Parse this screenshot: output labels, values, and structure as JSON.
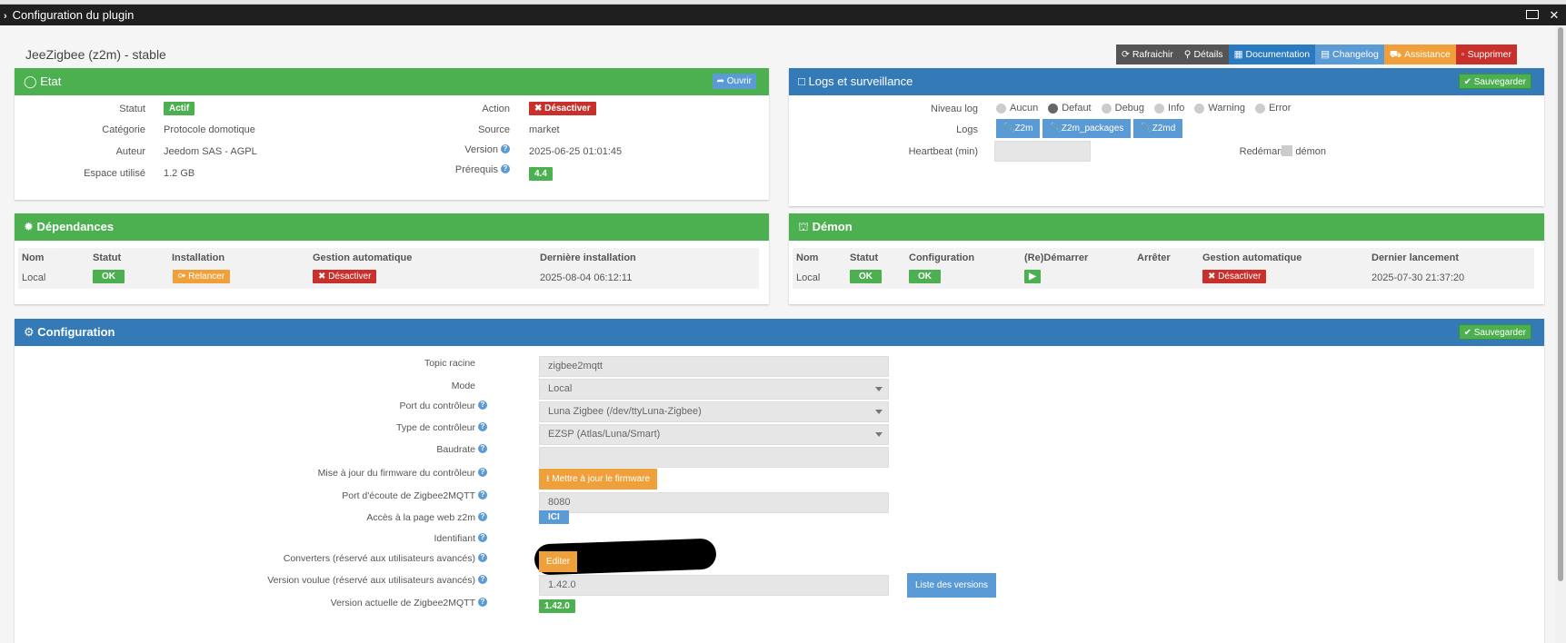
{
  "window": {
    "title": "Configuration du plugin"
  },
  "plugin": {
    "title": "JeeZigbee (z2m) - stable"
  },
  "toolbar": {
    "refresh": "Rafraichir",
    "details": "Détails",
    "documentation": "Documentation",
    "changelog": "Changelog",
    "assistance": "Assistance",
    "delete": "Supprimer"
  },
  "etat": {
    "title": "Etat",
    "open_button": "Ouvrir",
    "statut_label": "Statut",
    "statut_value": "Actif",
    "categorie_label": "Catégorie",
    "categorie_value": "Protocole domotique",
    "auteur_label": "Auteur",
    "auteur_value": "Jeedom SAS - AGPL",
    "espace_label": "Espace utilisé",
    "espace_value": "1.2 GB",
    "action_label": "Action",
    "action_value": "Désactiver",
    "source_label": "Source",
    "source_value": "market",
    "version_label": "Version",
    "version_value": "2025-06-25 01:01:45",
    "prerequis_label": "Prérequis",
    "prerequis_value": "4.4"
  },
  "logs": {
    "title": "Logs et surveillance",
    "save_button": "Sauvegarder",
    "niveau_label": "Niveau log",
    "levels": [
      "Aucun",
      "Defaut",
      "Debug",
      "Info",
      "Warning",
      "Error"
    ],
    "selected_level": "Defaut",
    "logs_label": "Logs",
    "log_buttons": [
      "Z2m",
      "Z2m_packages",
      "Z2md"
    ],
    "heartbeat_label": "Heartbeat (min)",
    "heartbeat_value": "",
    "restart_label": "Redémarrer démon"
  },
  "dependances": {
    "title": "Dépendances",
    "headers": [
      "Nom",
      "Statut",
      "Installation",
      "Gestion automatique",
      "Dernière installation"
    ],
    "row": {
      "nom": "Local",
      "statut": "OK",
      "installation": "Relancer",
      "gestion": "Désactiver",
      "derniere": "2025-08-04 06:12:11"
    }
  },
  "demon": {
    "title": "Démon",
    "headers": [
      "Nom",
      "Statut",
      "Configuration",
      "(Re)Démarrer",
      "Arrêter",
      "Gestion automatique",
      "Dernier lancement"
    ],
    "row": {
      "nom": "Local",
      "statut": "OK",
      "configuration": "OK",
      "gestion": "Désactiver",
      "dernier": "2025-07-30 21:37:20"
    }
  },
  "configuration": {
    "title": "Configuration",
    "save_button": "Sauvegarder",
    "topic_label": "Topic racine",
    "topic_value": "zigbee2mqtt",
    "mode_label": "Mode",
    "mode_value": "Local",
    "port_label": "Port du contrôleur",
    "port_value": "Luna Zigbee (/dev/ttyLuna-Zigbee)",
    "type_label": "Type de contrôleur",
    "type_value": "EZSP (Atlas/Luna/Smart)",
    "baudrate_label": "Baudrate",
    "baudrate_value": "",
    "firmware_label": "Mise à jour du firmware du contrôleur",
    "firmware_button": "Mettre à jour le firmware",
    "listen_port_label": "Port d'écoute de Zigbee2MQTT",
    "listen_port_value": "8080",
    "web_label": "Accès à la page web z2m",
    "web_button": "ICI",
    "identifiant_label": "Identifiant",
    "converters_label": "Converters (réservé aux utilisateurs avancés)",
    "converters_button": "Editer",
    "version_voulue_label": "Version voulue (réservé aux utilisateurs avancés)",
    "version_voulue_value": "1.42.0",
    "versions_list_button": "Liste des versions",
    "version_actuelle_label": "Version actuelle de Zigbee2MQTT",
    "version_actuelle_value": "1.42.0"
  },
  "colors": {
    "green": "#4caf50",
    "blue": "#337ab7",
    "red": "#c9302c",
    "orange": "#f0a03a",
    "light_blue": "#5b9bd5"
  }
}
